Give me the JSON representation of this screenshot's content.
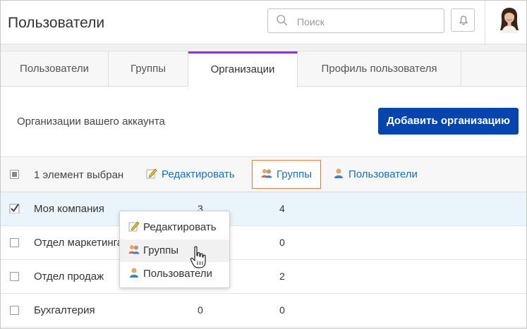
{
  "header": {
    "title": "Пользователи",
    "search_placeholder": "Поиск"
  },
  "tabs": [
    {
      "label": "Пользователи"
    },
    {
      "label": "Группы"
    },
    {
      "label": "Организации",
      "active": true
    },
    {
      "label": "Профиль пользователя"
    }
  ],
  "account": {
    "label": "Организации вашего аккаунта",
    "add_button": "Добавить организацию"
  },
  "actionbar": {
    "selected_text": "1 элемент выбран",
    "edit": "Редактировать",
    "groups": "Группы",
    "users": "Пользователи"
  },
  "rows": [
    {
      "name": "Моя компания",
      "col1": "3",
      "col2": "4",
      "checked": true
    },
    {
      "name": "Отдел маркетинга",
      "col1": "",
      "col2": "0",
      "checked": false
    },
    {
      "name": "Отдел продаж",
      "col1": "",
      "col2": "2",
      "checked": false
    },
    {
      "name": "Бухгалтерия",
      "col1": "0",
      "col2": "0",
      "checked": false
    }
  ],
  "context_menu": {
    "items": [
      {
        "label": "Редактировать",
        "icon": "pencil-icon"
      },
      {
        "label": "Группы",
        "icon": "groups-icon",
        "hover": true
      },
      {
        "label": "Пользователи",
        "icon": "user-icon"
      }
    ]
  },
  "colors": {
    "accent_tab": "#8a35c9",
    "primary_button": "#0645ad",
    "link": "#1a6fb5",
    "highlight_border": "#e4763a",
    "selected_row": "#e9f4fb"
  }
}
